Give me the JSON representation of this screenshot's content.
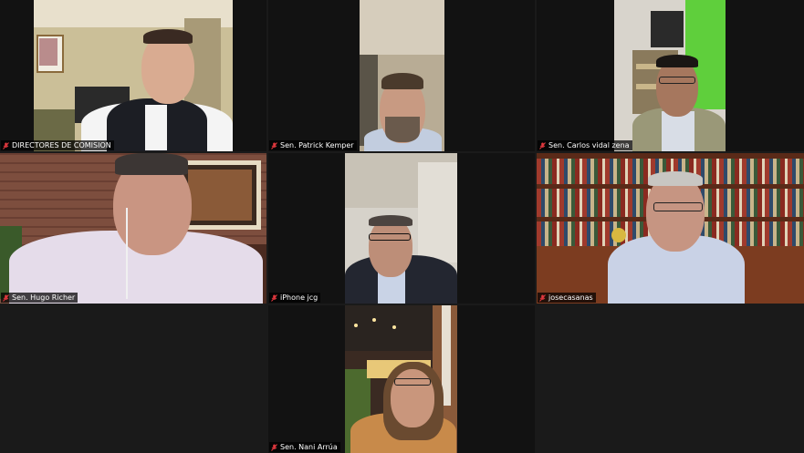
{
  "participants": [
    {
      "name": "DIRECTORES DE COMISION",
      "muted": true
    },
    {
      "name": "Sen. Patrick Kemper",
      "muted": true
    },
    {
      "name": "Sen. Carlos vidal zena",
      "muted": true
    },
    {
      "name": "Sen. Hugo Richer",
      "muted": true,
      "active_speaker": true
    },
    {
      "name": "iPhone jcg",
      "muted": true
    },
    {
      "name": "josecasanas",
      "muted": true
    },
    {
      "name": "Sen. Nani Arrúa",
      "muted": true
    }
  ],
  "colors": {
    "background": "#1a1a1a",
    "active_speaker_border": "#c9e84a",
    "muted_icon": "#e0383e"
  },
  "icons": {
    "mute": "microphone-muted-icon"
  }
}
